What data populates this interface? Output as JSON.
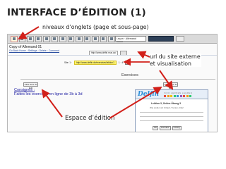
{
  "slide": {
    "title": "INTERFACE D’ÉDITION (1)",
    "callout_tabs": "niveaux d’onglets (page et sous-page)",
    "callout_url": "url du site externe\net visualisation",
    "callout_edit": "Espace d’édition"
  },
  "screenshot": {
    "doc_title": "Copy of Allemand 01",
    "doc_links": "Go Back Home · Settings · Delete · Comment",
    "toolbar": {
      "select_value": "Leçon · Allemand",
      "buttons": [
        "new-page",
        "new-subpage",
        "text",
        "image",
        "video",
        "link",
        "quiz",
        "exercise",
        "upload",
        "settings",
        "save",
        "preview",
        "share",
        "help"
      ]
    },
    "url_field": "http://www.delfin.mus.ac/",
    "page_line": {
      "prefix": "Site: 1 ·",
      "highlight": "http://www.delfin.de/exercises/lektion1",
      "suffix": "1 · 4"
    },
    "exercise_heading": "Exercices",
    "edit_label": "Click Here To Edit",
    "consignes_label": "Consignes :",
    "consignes_text": "Faites les exercices en ligne de 3b à 3d",
    "preview": {
      "logo": "Delfin",
      "nav_text": "INFO   LERNEN   LEHREN",
      "line1": "Lektion 3, Online-Übung 3",
      "line2": "Wie wollen wir Urlaub / Ferien, bitte!",
      "buttons": [
        "OK",
        "Korrektur",
        "Lösung"
      ]
    }
  },
  "colors": {
    "link_blue": "#1a1aa0",
    "annotation_red": "#d2201a",
    "url_highlight": "#fff36a",
    "delfin_blue": "#2c8ed8"
  }
}
